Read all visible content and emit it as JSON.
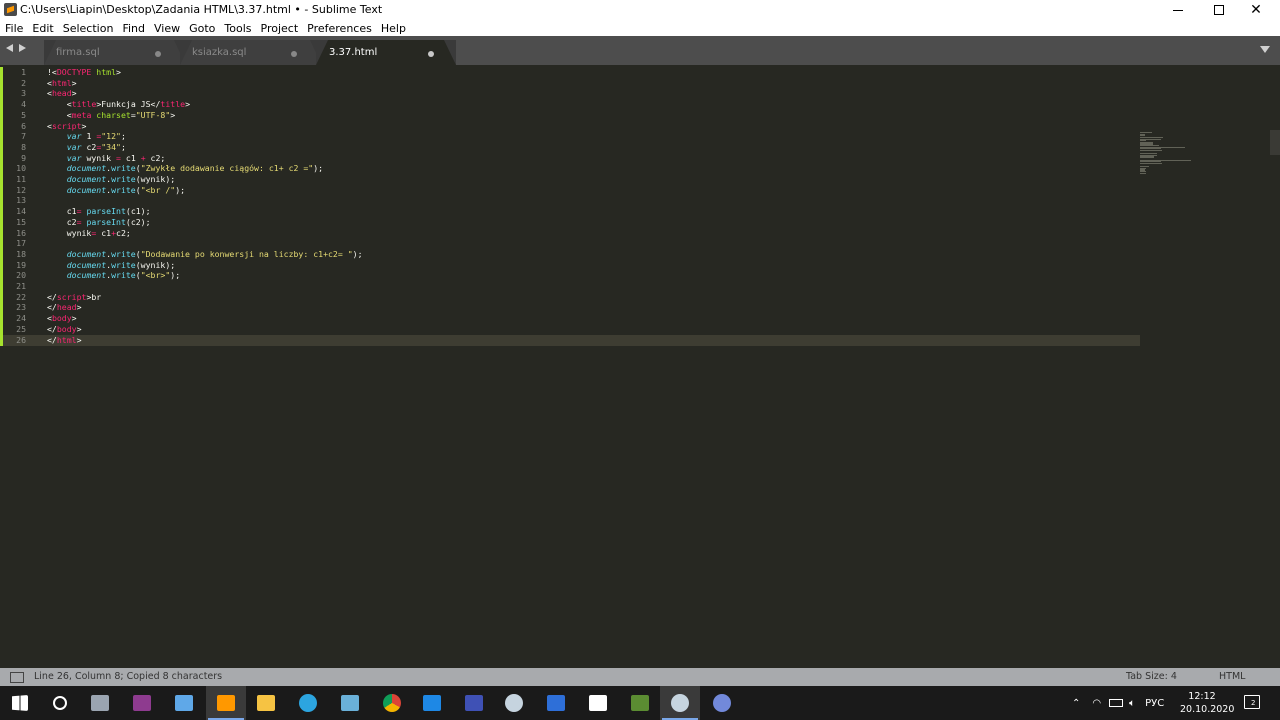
{
  "window": {
    "title": "C:\\Users\\Liapin\\Desktop\\Zadania HTML\\3.37.html • - Sublime Text",
    "minimize_icon": "minimize-icon",
    "maximize_icon": "maximize-icon",
    "close_icon": "close-icon"
  },
  "menu": [
    "File",
    "Edit",
    "Selection",
    "Find",
    "View",
    "Goto",
    "Tools",
    "Project",
    "Preferences",
    "Help"
  ],
  "tabs": [
    {
      "label": "firma.sql",
      "active": false
    },
    {
      "label": "ksiazka.sql",
      "active": false
    },
    {
      "label": "3.37.html",
      "active": true
    }
  ],
  "editor": {
    "current_line": 26,
    "lines": [
      {
        "n": "1",
        "tokens": [
          [
            "t-txt",
            "!<"
          ],
          [
            "t-tag",
            "DOCTYPE"
          ],
          [
            "t-attr",
            " html"
          ],
          [
            "t-txt",
            ">"
          ]
        ]
      },
      {
        "n": "2",
        "tokens": [
          [
            "t-txt",
            "<"
          ],
          [
            "t-tag",
            "html"
          ],
          [
            "t-txt",
            ">"
          ]
        ]
      },
      {
        "n": "3",
        "tokens": [
          [
            "t-txt",
            "<"
          ],
          [
            "t-tag",
            "head"
          ],
          [
            "t-txt",
            ">"
          ]
        ]
      },
      {
        "n": "4",
        "tokens": [
          [
            "t-txt",
            "    <"
          ],
          [
            "t-tag",
            "title"
          ],
          [
            "t-txt",
            ">Funkcja JS</"
          ],
          [
            "t-tag",
            "title"
          ],
          [
            "t-txt",
            ">"
          ]
        ]
      },
      {
        "n": "5",
        "tokens": [
          [
            "t-txt",
            "    <"
          ],
          [
            "t-tag",
            "meta"
          ],
          [
            "t-attr",
            " charset"
          ],
          [
            "t-txt",
            "="
          ],
          [
            "t-str",
            "\"UTF-8\""
          ],
          [
            "t-txt",
            ">"
          ]
        ]
      },
      {
        "n": "6",
        "tokens": [
          [
            "t-txt",
            "<"
          ],
          [
            "t-tag",
            "script"
          ],
          [
            "t-txt",
            ">"
          ]
        ]
      },
      {
        "n": "7",
        "tokens": [
          [
            "t-kw",
            "    var"
          ],
          [
            "t-txt",
            " 1 "
          ],
          [
            "t-op",
            "="
          ],
          [
            "t-str",
            "\"12\""
          ],
          [
            "t-txt",
            ";"
          ]
        ]
      },
      {
        "n": "8",
        "tokens": [
          [
            "t-kw",
            "    var"
          ],
          [
            "t-txt",
            " c2"
          ],
          [
            "t-op",
            "="
          ],
          [
            "t-str",
            "\"34\""
          ],
          [
            "t-txt",
            ";"
          ]
        ]
      },
      {
        "n": "9",
        "tokens": [
          [
            "t-kw",
            "    var"
          ],
          [
            "t-txt",
            " wynik "
          ],
          [
            "t-op",
            "="
          ],
          [
            "t-txt",
            " c1 "
          ],
          [
            "t-op",
            "+"
          ],
          [
            "t-txt",
            " c2;"
          ]
        ]
      },
      {
        "n": "10",
        "tokens": [
          [
            "t-kw",
            "    document"
          ],
          [
            "t-txt",
            "."
          ],
          [
            "t-fn",
            "write"
          ],
          [
            "t-txt",
            "("
          ],
          [
            "t-str",
            "\"Zwykłe dodawanie ciągów: c1+ c2 =\""
          ],
          [
            "t-txt",
            ");"
          ]
        ]
      },
      {
        "n": "11",
        "tokens": [
          [
            "t-kw",
            "    document"
          ],
          [
            "t-txt",
            "."
          ],
          [
            "t-fn",
            "write"
          ],
          [
            "t-txt",
            "(wynik);"
          ]
        ]
      },
      {
        "n": "12",
        "tokens": [
          [
            "t-kw",
            "    document"
          ],
          [
            "t-txt",
            "."
          ],
          [
            "t-fn",
            "write"
          ],
          [
            "t-txt",
            "("
          ],
          [
            "t-str",
            "\"<br /\""
          ],
          [
            "t-txt",
            ");"
          ]
        ]
      },
      {
        "n": "13",
        "tokens": []
      },
      {
        "n": "14",
        "tokens": [
          [
            "t-txt",
            "    c1"
          ],
          [
            "t-op",
            "="
          ],
          [
            "t-txt",
            " "
          ],
          [
            "t-fn",
            "parseInt"
          ],
          [
            "t-txt",
            "(c1);"
          ]
        ]
      },
      {
        "n": "15",
        "tokens": [
          [
            "t-txt",
            "    c2"
          ],
          [
            "t-op",
            "="
          ],
          [
            "t-txt",
            " "
          ],
          [
            "t-fn",
            "parseInt"
          ],
          [
            "t-txt",
            "(c2);"
          ]
        ]
      },
      {
        "n": "16",
        "tokens": [
          [
            "t-txt",
            "    wynik"
          ],
          [
            "t-op",
            "="
          ],
          [
            "t-txt",
            " c1"
          ],
          [
            "t-op",
            "+"
          ],
          [
            "t-txt",
            "c2;"
          ]
        ]
      },
      {
        "n": "17",
        "tokens": []
      },
      {
        "n": "18",
        "tokens": [
          [
            "t-kw",
            "    document"
          ],
          [
            "t-txt",
            "."
          ],
          [
            "t-fn",
            "write"
          ],
          [
            "t-txt",
            "("
          ],
          [
            "t-str",
            "\"Dodawanie po konwersji na liczby: c1+c2= \""
          ],
          [
            "t-txt",
            ");"
          ]
        ]
      },
      {
        "n": "19",
        "tokens": [
          [
            "t-kw",
            "    document"
          ],
          [
            "t-txt",
            "."
          ],
          [
            "t-fn",
            "write"
          ],
          [
            "t-txt",
            "(wynik);"
          ]
        ]
      },
      {
        "n": "20",
        "tokens": [
          [
            "t-kw",
            "    document"
          ],
          [
            "t-txt",
            "."
          ],
          [
            "t-fn",
            "write"
          ],
          [
            "t-txt",
            "("
          ],
          [
            "t-str",
            "\"<br>\""
          ],
          [
            "t-txt",
            ");"
          ]
        ]
      },
      {
        "n": "21",
        "tokens": []
      },
      {
        "n": "22",
        "tokens": [
          [
            "t-txt",
            "</"
          ],
          [
            "t-tag",
            "script"
          ],
          [
            "t-txt",
            ">br"
          ]
        ]
      },
      {
        "n": "23",
        "tokens": [
          [
            "t-txt",
            "</"
          ],
          [
            "t-tag",
            "head"
          ],
          [
            "t-txt",
            ">"
          ]
        ]
      },
      {
        "n": "24",
        "tokens": [
          [
            "t-txt",
            "<"
          ],
          [
            "t-tag",
            "body"
          ],
          [
            "t-txt",
            ">"
          ]
        ]
      },
      {
        "n": "25",
        "tokens": [
          [
            "t-txt",
            "</"
          ],
          [
            "t-tag",
            "body"
          ],
          [
            "t-txt",
            ">"
          ]
        ]
      },
      {
        "n": "26",
        "tokens": [
          [
            "t-txt",
            "</"
          ],
          [
            "t-tag",
            "html"
          ],
          [
            "t-txt",
            ">"
          ]
        ]
      }
    ]
  },
  "status": {
    "message": "Line 26, Column 8; Copied 8 characters",
    "tab_size": "Tab Size: 4",
    "syntax": "HTML"
  },
  "taskbar": {
    "apps": [
      {
        "name": "start-icon",
        "color": "#ffffff"
      },
      {
        "name": "search-icon",
        "color": "#ffffff"
      },
      {
        "name": "task-view-icon",
        "color": "#9aa4b0"
      },
      {
        "name": "winrar-icon",
        "color": "#8e3b8f"
      },
      {
        "name": "desktop-icon",
        "color": "#5fa8e8"
      },
      {
        "name": "sublime-text-icon",
        "color": "#ff9800",
        "active": true
      },
      {
        "name": "file-explorer-icon",
        "color": "#f6c343"
      },
      {
        "name": "telegram-icon",
        "color": "#2ca5e0"
      },
      {
        "name": "notes-icon",
        "color": "#6ab0d8"
      },
      {
        "name": "chrome-icon",
        "color": "#db4437"
      },
      {
        "name": "mail-icon",
        "color": "#1e88e5"
      },
      {
        "name": "dev-icon",
        "color": "#3f51b5"
      },
      {
        "name": "steam-icon",
        "color": "#c6d4df"
      },
      {
        "name": "remote-desktop-icon",
        "color": "#2e6fd8"
      },
      {
        "name": "document-icon",
        "color": "#ffffff"
      },
      {
        "name": "minecraft-icon",
        "color": "#5b8c32"
      },
      {
        "name": "steam-client-icon",
        "color": "#c6d4df",
        "active": true
      },
      {
        "name": "discord-icon",
        "color": "#7289da"
      }
    ],
    "tray": {
      "chevron": "chevron-up-icon",
      "network": "wifi-icon",
      "battery": "battery-icon",
      "volume": "volume-icon",
      "language": "РУС",
      "time": "12:12",
      "date": "20.10.2020",
      "notifications_count": "2"
    }
  }
}
